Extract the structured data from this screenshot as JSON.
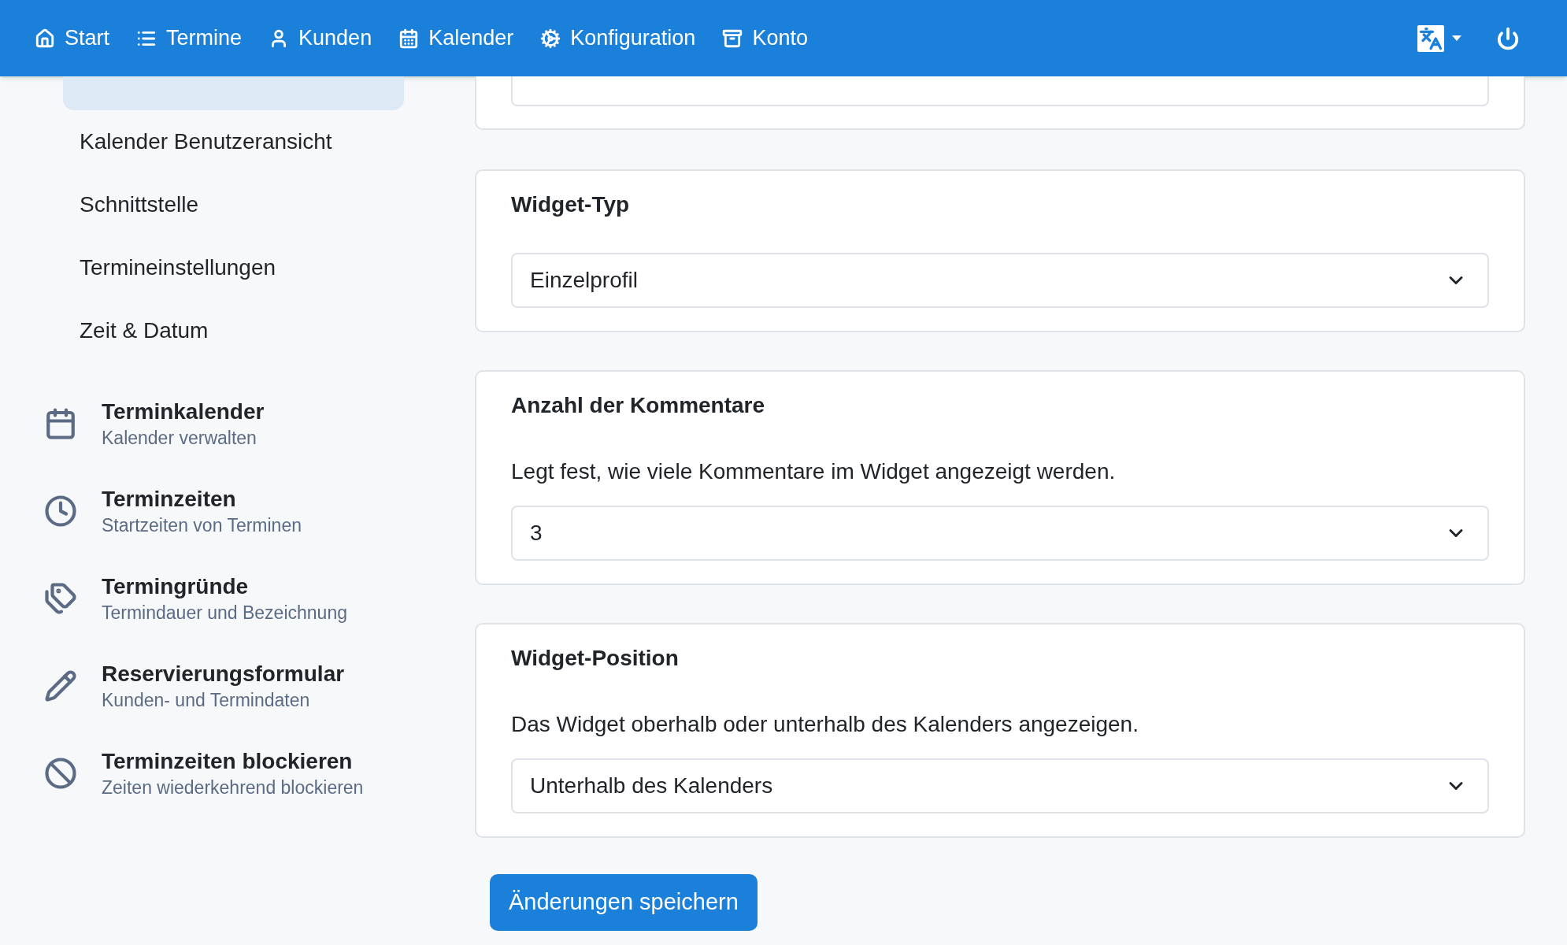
{
  "navbar": {
    "items": [
      {
        "label": "Start"
      },
      {
        "label": "Termine"
      },
      {
        "label": "Kunden"
      },
      {
        "label": "Kalender"
      },
      {
        "label": "Konfiguration"
      },
      {
        "label": "Konto"
      }
    ]
  },
  "sidebar": {
    "sub_items": [
      {
        "label": "Kalender Benutzeransicht"
      },
      {
        "label": "Schnittstelle"
      },
      {
        "label": "Termineinstellungen"
      },
      {
        "label": "Zeit & Datum"
      }
    ],
    "sections": [
      {
        "title": "Terminkalender",
        "subtitle": "Kalender verwalten"
      },
      {
        "title": "Terminzeiten",
        "subtitle": "Startzeiten von Terminen"
      },
      {
        "title": "Termingründe",
        "subtitle": "Termindauer und Bezeichnung"
      },
      {
        "title": "Reservierungsformular",
        "subtitle": "Kunden- und Termindaten"
      },
      {
        "title": "Terminzeiten blockieren",
        "subtitle": "Zeiten wiederkehrend blockieren"
      }
    ]
  },
  "cards": [
    {
      "title": "Widget-Typ",
      "value": "Einzelprofil"
    },
    {
      "title": "Anzahl der Kommentare",
      "description": "Legt fest, wie viele Kommentare im Widget angezeigt werden.",
      "value": "3"
    },
    {
      "title": "Widget-Position",
      "description": "Das Widget oberhalb oder unterhalb des Kalenders angezeigen.",
      "value": "Unterhalb des Kalenders"
    }
  ],
  "save_button": "Änderungen speichern"
}
